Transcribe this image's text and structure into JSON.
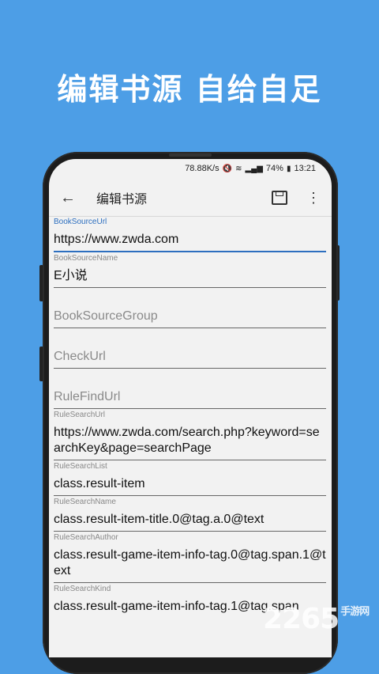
{
  "headline": "编辑书源  自给自足",
  "status": {
    "speed": "78.88K/s",
    "battery": "74%",
    "time": "13:21"
  },
  "toolbar": {
    "back_icon": "arrow-left-icon",
    "title": "编辑书源",
    "save_icon": "save-icon",
    "more_icon": "more-vertical-icon"
  },
  "fields": [
    {
      "label": "BookSourceUrl",
      "value": "https://www.zwda.com",
      "placeholder": ""
    },
    {
      "label": "BookSourceName",
      "value": "E小说",
      "placeholder": ""
    },
    {
      "label": "",
      "value": "",
      "placeholder": "BookSourceGroup"
    },
    {
      "label": "",
      "value": "",
      "placeholder": "CheckUrl"
    },
    {
      "label": "",
      "value": "",
      "placeholder": "RuleFindUrl"
    },
    {
      "label": "RuleSearchUrl",
      "value": "https://www.zwda.com/search.php?keyword=searchKey&page=searchPage",
      "placeholder": ""
    },
    {
      "label": "RuleSearchList",
      "value": "class.result-item",
      "placeholder": ""
    },
    {
      "label": "RuleSearchName",
      "value": "class.result-item-title.0@tag.a.0@text",
      "placeholder": ""
    },
    {
      "label": "RuleSearchAuthor",
      "value": "class.result-game-item-info-tag.0@tag.span.1@text",
      "placeholder": ""
    },
    {
      "label": "RuleSearchKind",
      "value": "class.result-game-item-info-tag.1@tag.span",
      "placeholder": ""
    }
  ],
  "watermark": {
    "main": "2265",
    "suffix": "手游网"
  },
  "colors": {
    "background": "#4d9ee6",
    "accent": "#2d6fbf"
  }
}
